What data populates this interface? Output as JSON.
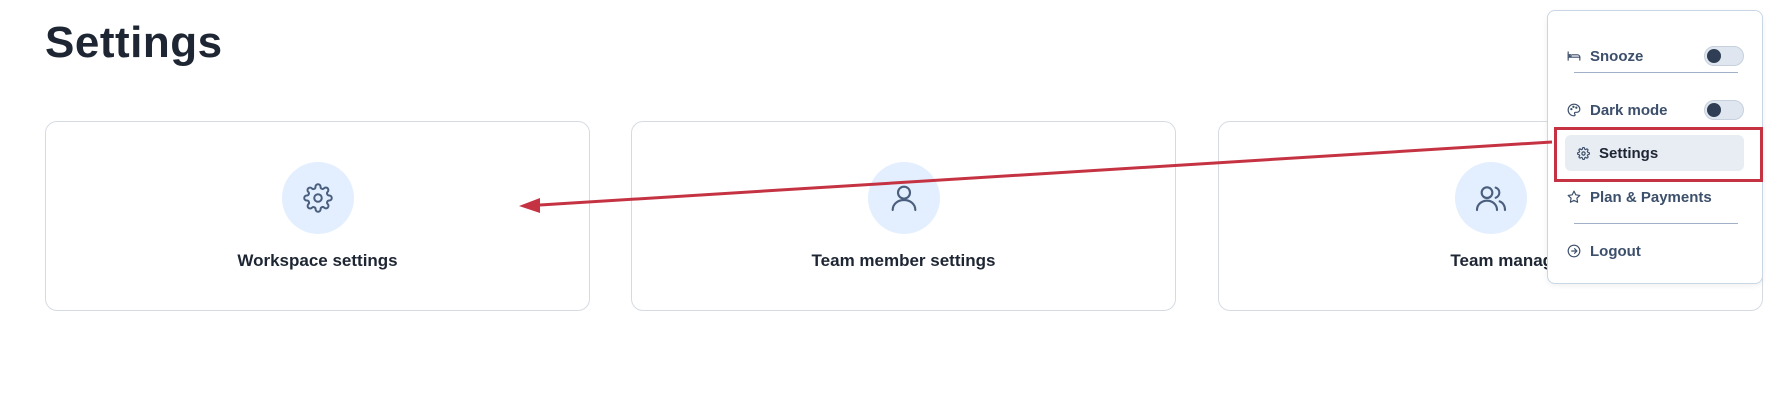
{
  "page": {
    "title": "Settings"
  },
  "cards": [
    {
      "label": "Workspace settings",
      "icon": "gear-icon"
    },
    {
      "label": "Team member settings",
      "icon": "user-icon"
    },
    {
      "label": "Team managem",
      "icon": "users-icon"
    }
  ],
  "menu": {
    "snooze": {
      "label": "Snooze",
      "icon": "bed-icon",
      "toggle_on": false
    },
    "dark_mode": {
      "label": "Dark mode",
      "icon": "palette-icon",
      "toggle_on": false
    },
    "settings": {
      "label": "Settings",
      "icon": "gear-icon"
    },
    "plan": {
      "label": "Plan & Payments",
      "icon": "star-icon"
    },
    "logout": {
      "label": "Logout",
      "icon": "logout-icon"
    }
  },
  "colors": {
    "accent_circle": "#e3efff",
    "annotation": "#c53343",
    "text_dark": "#1e2633",
    "menu_text": "#3c4f6b"
  }
}
